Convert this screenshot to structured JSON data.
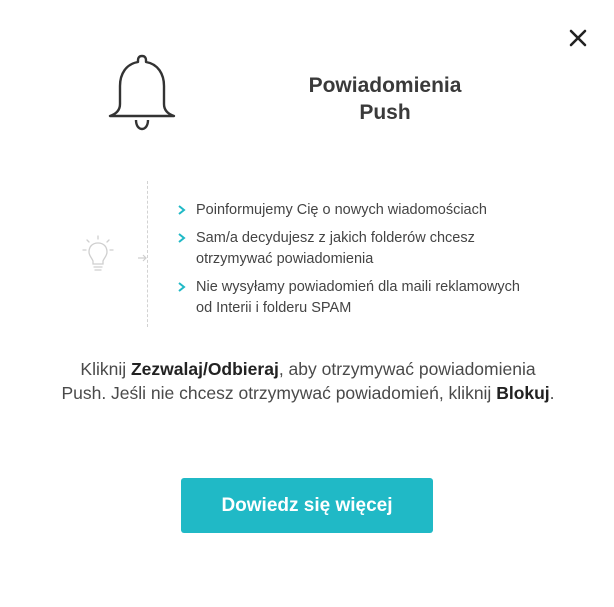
{
  "dialog": {
    "title_line1": "Powiadomienia",
    "title_line2": "Push",
    "close_icon": "close-icon",
    "bell_icon": "bell-icon",
    "bulb_icon": "lightbulb-icon"
  },
  "features": [
    {
      "text": "Poinformujemy Cię o nowych wiadomościach"
    },
    {
      "text": "Sam/a decydujesz z jakich folderów chcesz otrzymywać powiadomienia"
    },
    {
      "text": "Nie wysyłamy powiadomień dla maili reklamowych od Interii i folderu SPAM"
    }
  ],
  "instructions": {
    "part1": "Kliknij ",
    "bold1": "Zezwalaj/Odbieraj",
    "part2": ", aby otrzymywać powiadomienia Push. Jeśli nie chcesz otrzymywać powiadomień, kliknij ",
    "bold2": "Blokuj",
    "part3": "."
  },
  "cta": {
    "label": "Dowiedz się więcej"
  },
  "colors": {
    "accent": "#20b9c6",
    "chevron": "#20b9c6",
    "text": "#333333"
  }
}
